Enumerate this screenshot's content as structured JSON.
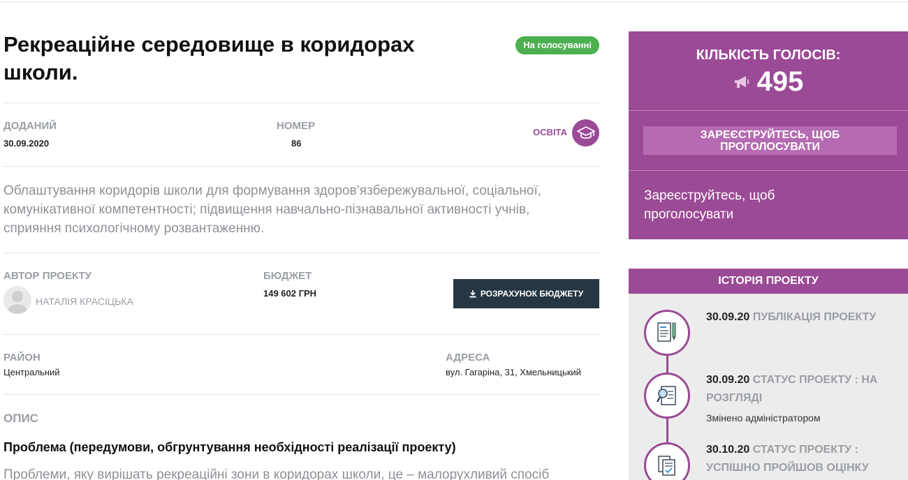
{
  "project": {
    "title": "Рекреаційне середовище в коридорах школи.",
    "status_badge": "На голосуванні",
    "added_label": "ДОДАНИЙ",
    "added_date": "30.09.2020",
    "number_label": "НОМЕР",
    "number": "86",
    "category": "ОСВІТА",
    "category_icon": "graduation-cap-icon",
    "summary": "Облаштування коридорів школи для формування здоров’язбережувальної, соціальної, комунікативної компетентності; підвищення навчально-пізнавальної активності учнів, сприяння психологічному розвантаженню.",
    "author_label": "АВТОР ПРОЕКТУ",
    "author_name": "НАТАЛІЯ КРАСІЦЬКА",
    "budget_label": "БЮДЖЕТ",
    "budget_value": "149 602 ГРН",
    "budget_button": "РОЗРАХУНОК БЮДЖЕТУ",
    "district_label": "РАЙОН",
    "district_value": "Центральний",
    "address_label": "АДРЕСА",
    "address_value": "вул. Гагаріна, 31, Хмельницький",
    "description_label": "ОПИС",
    "problem_heading": "Проблема (передумови, обгрунтування необхідності реалізації проекту)",
    "problem_text": "Проблеми, яку вирішать рекреаційні зони в коридорах школи, це – малорухливий спосіб"
  },
  "votes": {
    "title": "КІЛЬКІСТЬ ГОЛОСІВ:",
    "count": "495",
    "icon": "megaphone-icon",
    "register_button": "ЗАРЕЄСТРУЙТЕСЬ, ЩОБ ПРОГОЛОСУВАТИ",
    "register_text": "Зареєструйтесь, щоб проголосувати"
  },
  "history": {
    "title": "ІСТОРІЯ ПРОЕКТУ",
    "events": [
      {
        "date": "30.09.20",
        "status": "ПУБЛІКАЦІЯ ПРОЕКТУ",
        "sub": "",
        "icon": "document-pen-icon"
      },
      {
        "date": "30.09.20",
        "status": "СТАТУС ПРОЕКТУ : НА РОЗГЛЯДІ",
        "sub": "Змінено адміністратором",
        "icon": "magnifier-document-icon"
      },
      {
        "date": "30.10.20",
        "status": "СТАТУС ПРОЕКТУ : УСПІШНО ПРОЙШОВ ОЦІНКУ",
        "sub": "",
        "icon": "approved-document-icon"
      }
    ]
  },
  "colors": {
    "accent": "#9b4a96",
    "badge": "#4caf50",
    "dark_button": "#263644"
  }
}
